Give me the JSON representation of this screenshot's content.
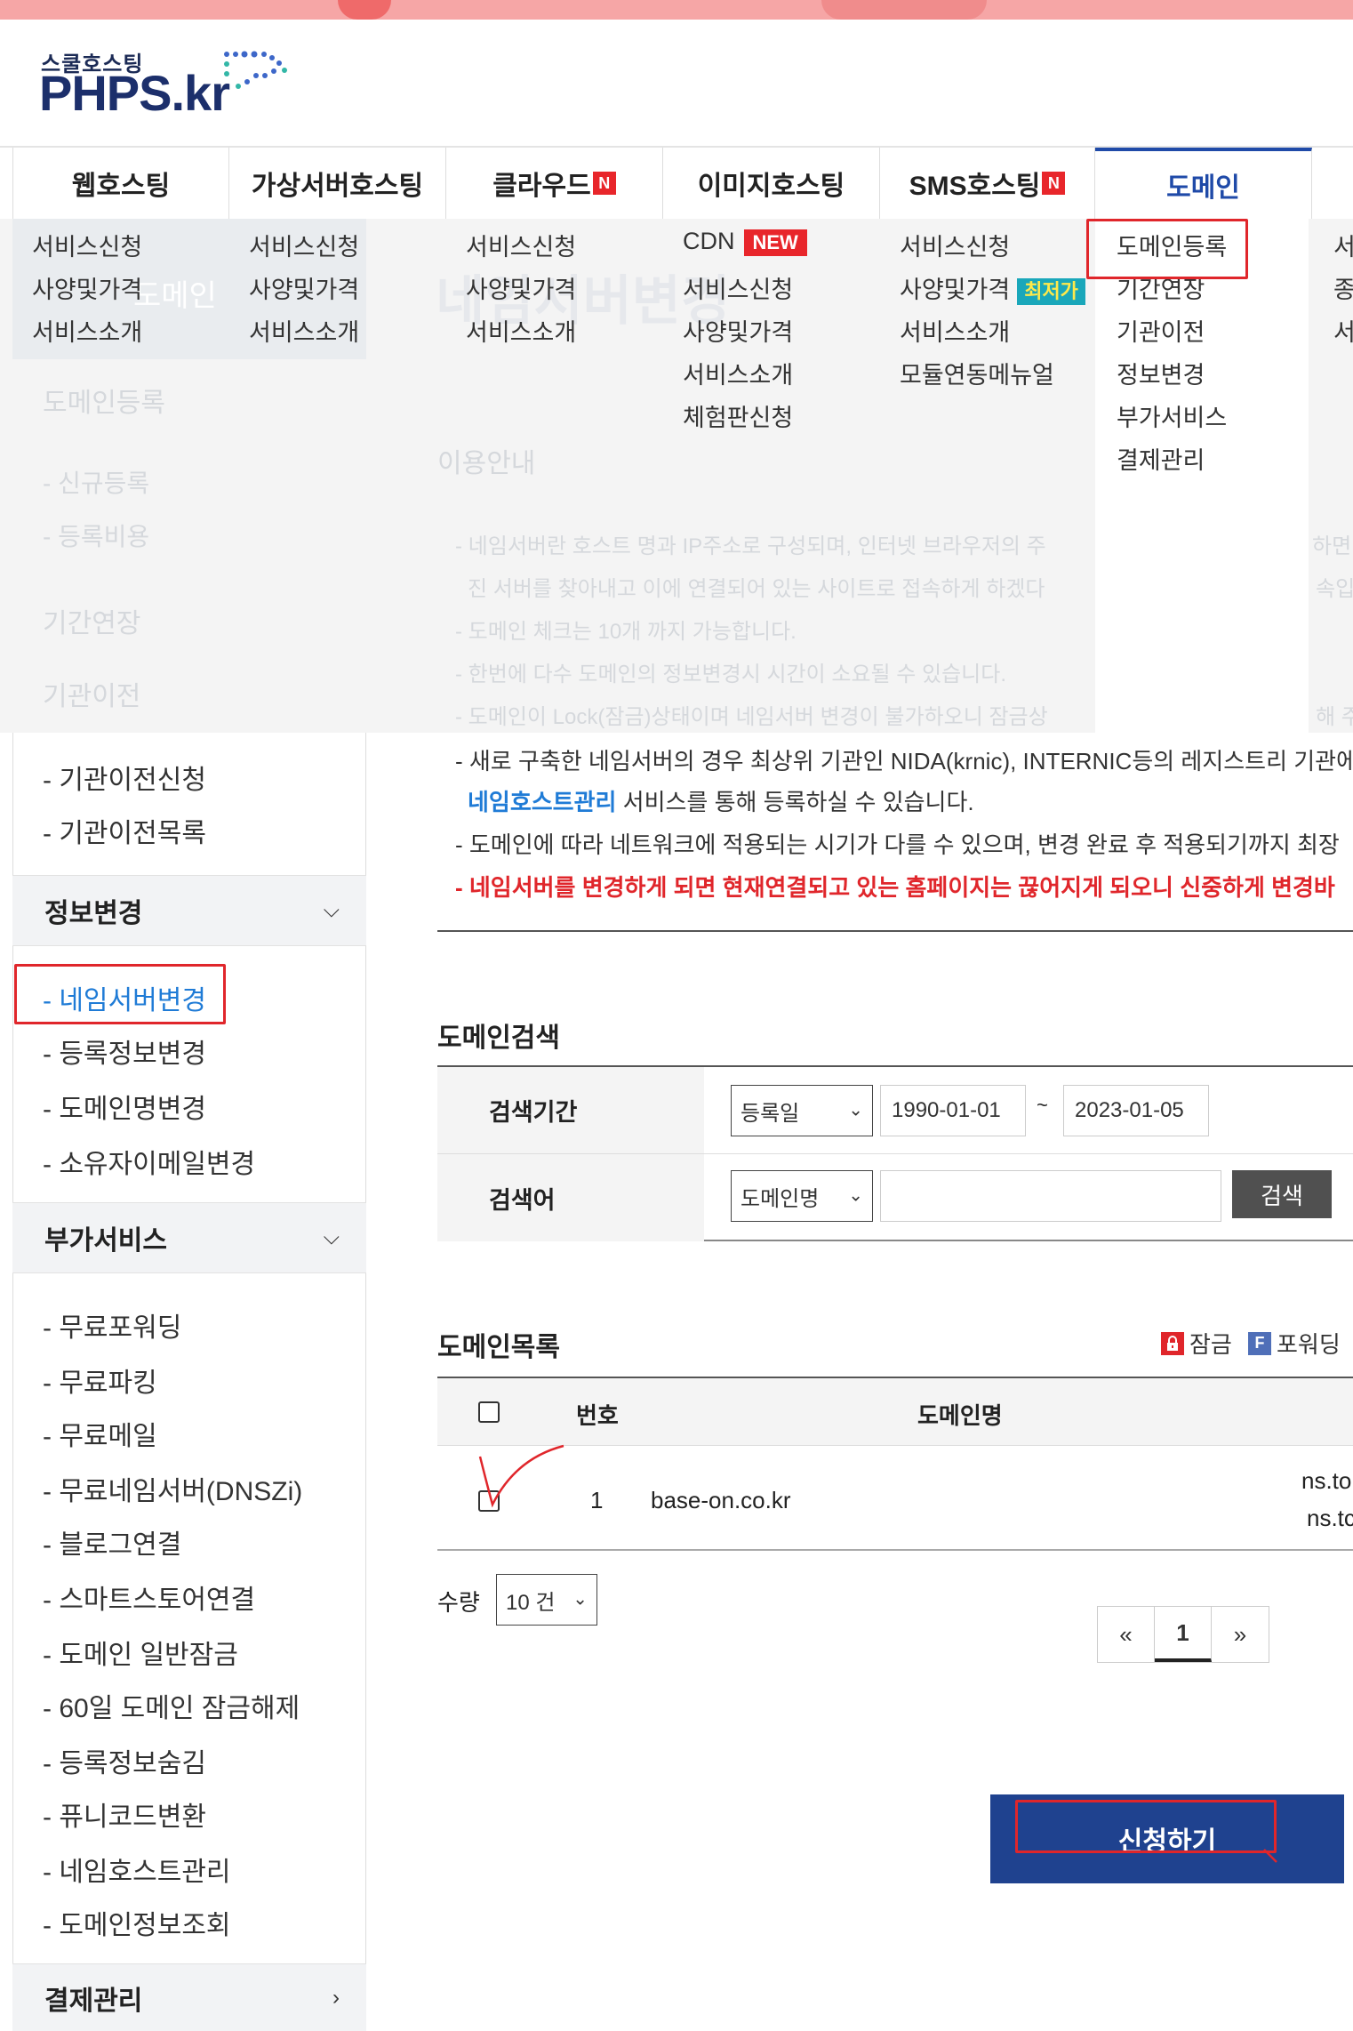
{
  "logo": {
    "sub": "스쿨호스팅",
    "main": "PHPS.kr"
  },
  "gnb": [
    {
      "label": "웹호스팅",
      "badge": ""
    },
    {
      "label": "가상서버호스팅",
      "badge": ""
    },
    {
      "label": "클라우드",
      "badge": "N"
    },
    {
      "label": "이미지호스팅",
      "badge": ""
    },
    {
      "label": "SMS호스팅",
      "badge": "N"
    },
    {
      "label": "도메인",
      "badge": ""
    }
  ],
  "submenus": {
    "web": [
      "서비스신청",
      "사양및가격",
      "서비스소개"
    ],
    "vserver": [
      "서비스신청",
      "사양및가격",
      "서비스소개"
    ],
    "cloud": [
      "서비스신청",
      "사양및가격",
      "서비스소개"
    ],
    "image": {
      "cdn": "CDN",
      "new_badge": "NEW",
      "items": [
        "서비스신청",
        "사양및가격",
        "서비스소개",
        "체험판신청"
      ]
    },
    "sms": {
      "items": [
        "서비스신청",
        "사양및가격",
        "서비스소개",
        "모듈연동메뉴얼"
      ],
      "best_badge": "최저가"
    },
    "domain": [
      "도메인등록",
      "기간연장",
      "기관이전",
      "정보변경",
      "부가서비스",
      "결제관리"
    ],
    "extra": [
      "서",
      "종",
      "서"
    ]
  },
  "ghost": {
    "breadcrumb": "도메인",
    "title": "네임서버변경",
    "side": [
      "도메인등록",
      "- 신규등록",
      "- 등록비용",
      "기간연장",
      "기관이전"
    ],
    "info_title": "이용안내",
    "lines": [
      "- 네임서버란 호스트 명과 IP주소로 구성되며, 인터넷 브라우저의 주",
      "진 서버를 찾아내고 이에 연결되어 있는 사이트로 접속하게 하겠다",
      "- 도메인 체크는 10개 까지 가능합니다.",
      "- 한번에 다수 도메인의 정보변경시 시간이 소요될 수 있습니다.",
      "- 도메인이 Lock(잠금)상태이며 네임서버 변경이 불가하오니 잠금상"
    ],
    "right": [
      "하면",
      "속입니",
      "해 주"
    ]
  },
  "sidebar": {
    "transfer_items": [
      "- 기관이전신청",
      "- 기관이전목록"
    ],
    "info_change_head": "정보변경",
    "info_change_items": [
      "- 네임서버변경",
      "- 등록정보변경",
      "- 도메인명변경",
      "- 소유자이메일변경"
    ],
    "addon_head": "부가서비스",
    "addon_items": [
      "- 무료포워딩",
      "- 무료파킹",
      "- 무료메일",
      "- 무료네임서버(DNSZi)",
      "- 블로그연결",
      "- 스마트스토어연결",
      "- 도메인 일반잠금",
      "- 60일 도메인 잠금해제",
      "- 등록정보숨김",
      "- 퓨니코드변환",
      "- 네임호스트관리",
      "- 도메인정보조회"
    ],
    "payment_head": "결제관리"
  },
  "notes": {
    "line1": "- 새로 구축한 네임서버의 경우 최상위 기관인 NIDA(krnic), INTERNIC등의 레지스트리 기관에",
    "line2_link": "네임호스트관리",
    "line2_rest": " 서비스를 통해 등록하실 수 있습니다.",
    "line3": "- 도메인에 따라 네트워크에 적용되는 시기가 다를 수 있으며, 변경 완료 후 적용되기까지 최장",
    "line4": "- 네임서버를 변경하게 되면 현재연결되고 있는 홈페이지는 끊어지게 되오니 신중하게 변경바"
  },
  "search": {
    "title": "도메인검색",
    "period_label": "검색기간",
    "period_select": "등록일",
    "date_from": "1990-01-01",
    "tilde": "~",
    "date_to": "2023-01-05",
    "keyword_label": "검색어",
    "keyword_select": "도메인명",
    "keyword_value": "",
    "button": "검색"
  },
  "list": {
    "title": "도메인목록",
    "legend_lock": "잠금",
    "legend_forward": "포워딩",
    "legend_forward_icon": "F",
    "col_no": "번호",
    "col_domain": "도메인명",
    "rows": [
      {
        "no": "1",
        "domain": "base-on.co.kr",
        "ns1": "ns.to",
        "ns2": "ns.tc"
      }
    ]
  },
  "quantity": {
    "label": "수량",
    "value": "10 건"
  },
  "pager": {
    "prev": "«",
    "current": "1",
    "next": "»"
  },
  "apply_button": "신청하기",
  "colors": {
    "brand": "#1c2f6b",
    "accent_blue": "#1f4aa8",
    "warn_red": "#e0262b",
    "apply_bg": "#1f428f"
  }
}
